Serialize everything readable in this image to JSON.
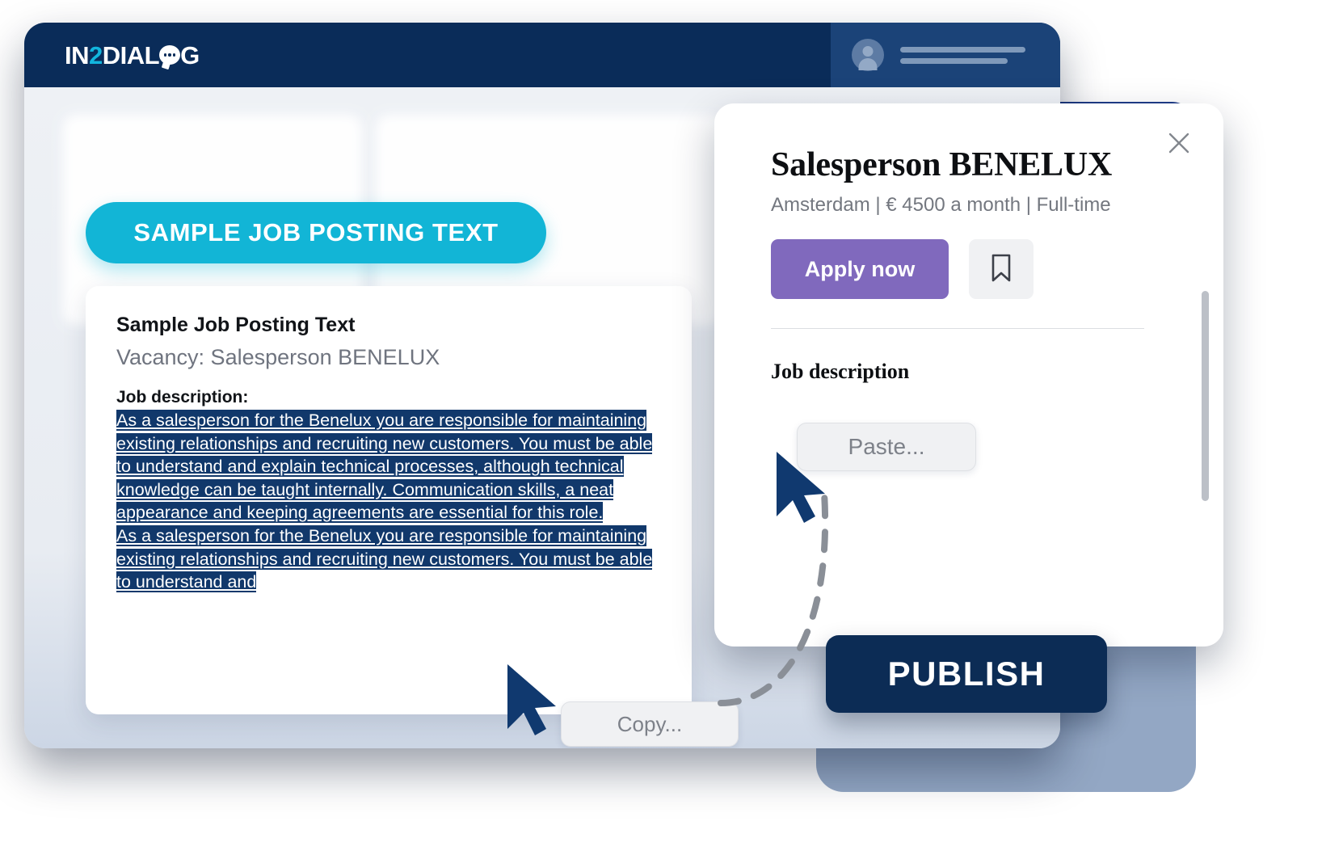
{
  "app": {
    "logo_prefix": "IN",
    "logo_two": "2",
    "logo_mid": "DIAL",
    "logo_suffix": "G"
  },
  "badge": {
    "sample_label": "SAMPLE JOB POSTING TEXT"
  },
  "document": {
    "title": "Sample Job Posting Text",
    "vacancy": "Vacancy: Salesperson BENELUX",
    "jd_label": "Job description:",
    "paragraph_1": "As a salesperson for the Benelux you are responsible for maintaining existing relationships and recruiting new customers. You must be able to understand and explain technical processes, although technical knowledge can be taught internally. Communication skills, a neat appearance and keeping agreements are essential for this role.",
    "paragraph_2": "As a salesperson for the Benelux you are responsible for maintaining existing relationships and recruiting new customers. You must be able to understand and"
  },
  "copy_button": {
    "label": "Copy..."
  },
  "modal": {
    "title": "Salesperson BENELUX",
    "subtitle": "Amsterdam | € 4500 a month | Full-time",
    "apply_label": "Apply now",
    "jd_heading": "Job description",
    "paste_label": "Paste..."
  },
  "publish": {
    "label": "PUBLISH"
  },
  "icons": {
    "close": "close-icon",
    "bookmark": "bookmark-icon",
    "avatar": "avatar-icon",
    "cursor": "cursor-arrow-icon"
  },
  "colors": {
    "brand_navy": "#0a2c59",
    "brand_cyan": "#12b5d6",
    "accent_purple": "#8069bd",
    "selection_navy": "#11386b",
    "publish_navy": "#0c2c55"
  }
}
